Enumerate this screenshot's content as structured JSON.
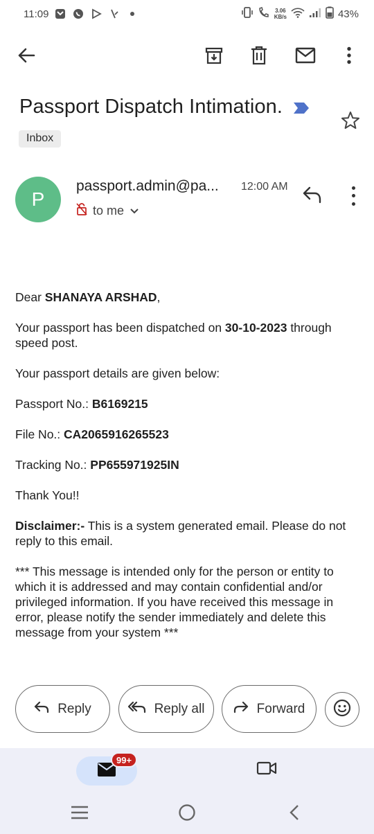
{
  "status_bar": {
    "time": "11:09",
    "net_speed_value": "3.06",
    "net_speed_unit": "KB/s",
    "battery": "43%"
  },
  "toolbar": {
    "back": "arrow-back-icon",
    "archive": "archive-icon",
    "delete": "delete-icon",
    "mark_unread": "mail-icon",
    "more": "more-vert-icon"
  },
  "email": {
    "subject": "Passport Dispatch Intimation.",
    "label": "Inbox",
    "sender_initial": "P",
    "sender": "passport.admin@pa...",
    "time": "12:00 AM",
    "recipient": "to me",
    "body": {
      "greeting_prefix": "Dear ",
      "greeting_name": "SHANAYA ARSHAD",
      "greeting_suffix": ",",
      "dispatch_prefix": "Your passport has been dispatched on ",
      "dispatch_date": "30-10-2023",
      "dispatch_suffix": " through speed post.",
      "details_intro": "Your passport details are given below:",
      "passport_label": "Passport No.: ",
      "passport_no": "B6169215",
      "file_label": "File No.: ",
      "file_no": "CA2065916265523",
      "tracking_label": "Tracking No.: ",
      "tracking_no": "PP655971925IN",
      "thanks": "Thank You!!",
      "disclaimer_label": "Disclaimer:-",
      "disclaimer_text": " This is a system generated email. Please do not reply to this email.",
      "notice": "*** This message is intended only for the person or entity to which it is addressed and may contain confidential and/or privileged information. If you have received this message in error, please notify the sender immediately and delete this message from your system ***"
    }
  },
  "actions": {
    "reply": "Reply",
    "reply_all": "Reply all",
    "forward": "Forward"
  },
  "bottom_nav": {
    "mail_badge": "99+"
  },
  "colors": {
    "avatar": "#5ebd88",
    "importance": "#4f72c9",
    "badge": "#c5221f",
    "nav_bg": "#eeeff8",
    "mail_tab_bg": "#d5e3fb"
  }
}
